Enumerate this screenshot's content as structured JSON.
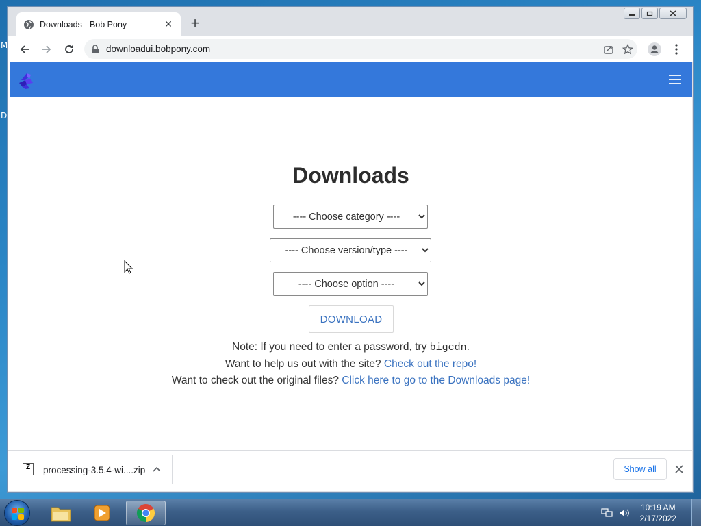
{
  "desktop": {
    "frag_top": "M",
    "frag_mid": "D"
  },
  "browser": {
    "tab_title": "Downloads - Bob Pony",
    "new_tab": "+",
    "url": "downloadui.bobpony.com"
  },
  "page": {
    "title": "Downloads",
    "selects": {
      "category": "---- Choose category ----",
      "version": "---- Choose version/type ----",
      "option": "---- Choose option ----"
    },
    "download_button": "DOWNLOAD",
    "note_prefix": "Note: If you need to enter a password, try ",
    "note_code": "bigcdn",
    "note_suffix": ".",
    "help_text": "Want to help us out with the site? ",
    "help_link": "Check out the repo!",
    "orig_text": "Want to check out the original files? ",
    "orig_link": "Click here to go to the Downloads page!"
  },
  "shelf": {
    "file_name": "processing-3.5.4-wi....zip",
    "file_badge": "Z",
    "show_all": "Show all"
  },
  "taskbar": {
    "time": "10:19 AM",
    "date": "2/17/2022"
  },
  "colors": {
    "navbar": "#3478db",
    "link": "#3b73c0"
  }
}
